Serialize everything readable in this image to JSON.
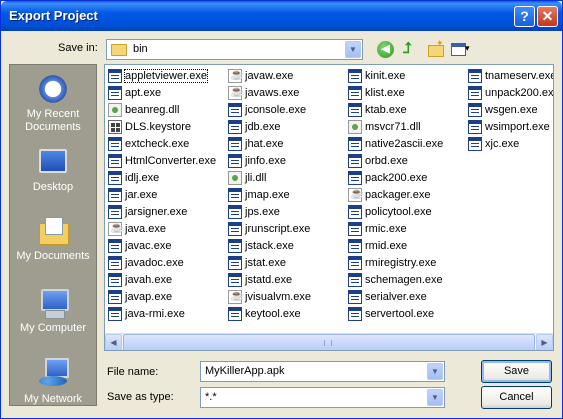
{
  "window": {
    "title": "Export Project"
  },
  "titlebar": {
    "help_label": "?",
    "close_label": "✕"
  },
  "lookin": {
    "label": "Save in:",
    "value": "bin"
  },
  "places": [
    {
      "label": "My Recent Documents",
      "icon": "recent-documents-icon"
    },
    {
      "label": "Desktop",
      "icon": "desktop-icon"
    },
    {
      "label": "My Documents",
      "icon": "my-documents-icon"
    },
    {
      "label": "My Computer",
      "icon": "my-computer-icon"
    },
    {
      "label": "My Network",
      "icon": "my-network-icon"
    }
  ],
  "files": {
    "col1": [
      {
        "name": "appletviewer.exe",
        "icon": "exe"
      },
      {
        "name": "apt.exe",
        "icon": "exe"
      },
      {
        "name": "beanreg.dll",
        "icon": "dll"
      },
      {
        "name": "DLS.keystore",
        "icon": "store"
      },
      {
        "name": "extcheck.exe",
        "icon": "exe"
      },
      {
        "name": "HtmlConverter.exe",
        "icon": "exe"
      },
      {
        "name": "idlj.exe",
        "icon": "exe"
      },
      {
        "name": "jar.exe",
        "icon": "exe"
      },
      {
        "name": "jarsigner.exe",
        "icon": "exe"
      },
      {
        "name": "java.exe",
        "icon": "java"
      },
      {
        "name": "javac.exe",
        "icon": "exe"
      },
      {
        "name": "javadoc.exe",
        "icon": "exe"
      },
      {
        "name": "javah.exe",
        "icon": "exe"
      },
      {
        "name": "javap.exe",
        "icon": "exe"
      },
      {
        "name": "java-rmi.exe",
        "icon": "exe"
      }
    ],
    "col2": [
      {
        "name": "javaw.exe",
        "icon": "java"
      },
      {
        "name": "javaws.exe",
        "icon": "java"
      },
      {
        "name": "jconsole.exe",
        "icon": "exe"
      },
      {
        "name": "jdb.exe",
        "icon": "exe"
      },
      {
        "name": "jhat.exe",
        "icon": "exe"
      },
      {
        "name": "jinfo.exe",
        "icon": "exe"
      },
      {
        "name": "jli.dll",
        "icon": "dll"
      },
      {
        "name": "jmap.exe",
        "icon": "exe"
      },
      {
        "name": "jps.exe",
        "icon": "exe"
      },
      {
        "name": "jrunscript.exe",
        "icon": "exe"
      },
      {
        "name": "jstack.exe",
        "icon": "exe"
      },
      {
        "name": "jstat.exe",
        "icon": "exe"
      },
      {
        "name": "jstatd.exe",
        "icon": "exe"
      },
      {
        "name": "jvisualvm.exe",
        "icon": "java"
      },
      {
        "name": "keytool.exe",
        "icon": "exe"
      }
    ],
    "col3": [
      {
        "name": "kinit.exe",
        "icon": "exe"
      },
      {
        "name": "klist.exe",
        "icon": "exe"
      },
      {
        "name": "ktab.exe",
        "icon": "exe"
      },
      {
        "name": "msvcr71.dll",
        "icon": "dll"
      },
      {
        "name": "native2ascii.exe",
        "icon": "exe"
      },
      {
        "name": "orbd.exe",
        "icon": "exe"
      },
      {
        "name": "pack200.exe",
        "icon": "exe"
      },
      {
        "name": "packager.exe",
        "icon": "java"
      },
      {
        "name": "policytool.exe",
        "icon": "exe"
      },
      {
        "name": "rmic.exe",
        "icon": "exe"
      },
      {
        "name": "rmid.exe",
        "icon": "exe"
      },
      {
        "name": "rmiregistry.exe",
        "icon": "exe"
      },
      {
        "name": "schemagen.exe",
        "icon": "exe"
      },
      {
        "name": "serialver.exe",
        "icon": "exe"
      },
      {
        "name": "servertool.exe",
        "icon": "exe"
      }
    ],
    "col4": [
      {
        "name": "tnameserv.exe",
        "icon": "exe"
      },
      {
        "name": "unpack200.exe",
        "icon": "exe"
      },
      {
        "name": "wsgen.exe",
        "icon": "exe"
      },
      {
        "name": "wsimport.exe",
        "icon": "exe"
      },
      {
        "name": "xjc.exe",
        "icon": "exe"
      }
    ]
  },
  "filename": {
    "label": "File name:",
    "value": "MyKillerApp.apk"
  },
  "savetype": {
    "label": "Save as type:",
    "value": "*.*"
  },
  "buttons": {
    "save": "Save",
    "cancel": "Cancel"
  }
}
